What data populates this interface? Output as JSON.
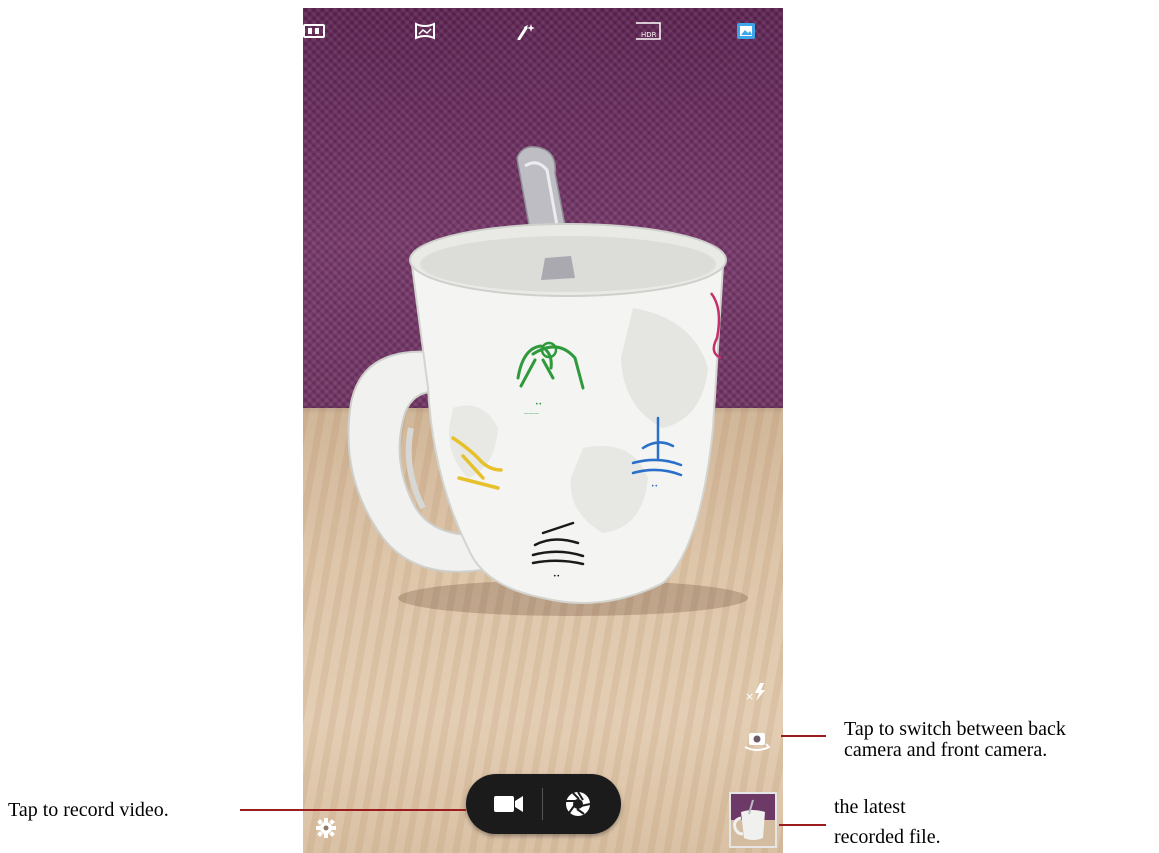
{
  "viewfinder": {
    "top_modes": [
      {
        "name": "panorama-wide-icon"
      },
      {
        "name": "panorama-icon"
      },
      {
        "name": "magic-wand-icon"
      },
      {
        "name": "hdr-icon",
        "text": "HDR"
      },
      {
        "name": "picture-mode-icon",
        "active": true
      }
    ],
    "side_controls": {
      "flash_icon": "flash-off-icon",
      "switch_camera_icon": "switch-camera-icon"
    },
    "capture_bar": {
      "video_icon": "video-camera-icon",
      "shutter_icon": "shutter-icon",
      "settings_icon": "gear-icon"
    }
  },
  "callouts": {
    "record_video": "Tap to record video.",
    "switch_camera_line1": "Tap to switch between back",
    "switch_camera_line2": "camera and front camera.",
    "latest_file_line1": "the latest",
    "latest_file_line2": "recorded file."
  },
  "colors": {
    "wall": "#6e2f60",
    "table": "#dcc3a6",
    "leader_line": "#9b1c1c",
    "active_mode": "#3ea6e8"
  }
}
